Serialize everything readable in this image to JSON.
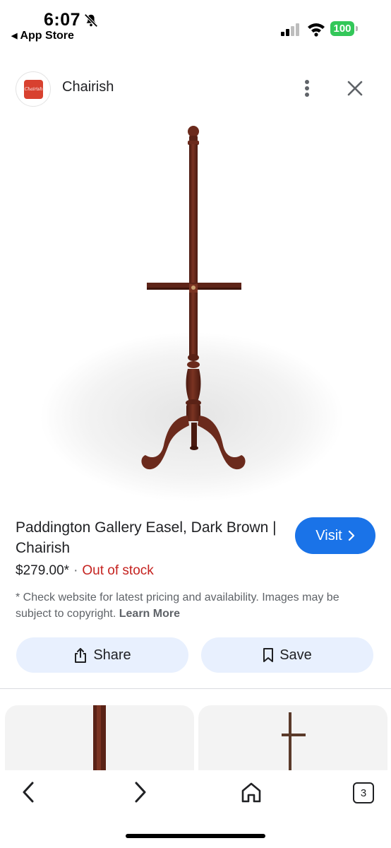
{
  "status_bar": {
    "time": "6:07",
    "back_app": "App Store",
    "battery": "100"
  },
  "header": {
    "logo_text": "Chairish",
    "site_name": "Chairish"
  },
  "product": {
    "title": "Paddington Gallery Easel, Dark Brown | Chairish",
    "price": "$279.00*",
    "separator": "·",
    "stock": "Out of stock",
    "visit_label": "Visit",
    "disclaimer": "* Check website for latest pricing and availability. Images may be subject to copyright.",
    "learn_more": "Learn More"
  },
  "actions": {
    "share_label": "Share",
    "save_label": "Save"
  },
  "nav": {
    "tab_count": "3"
  },
  "colors": {
    "accent": "#1a73e8",
    "out_of_stock": "#c5221f",
    "pill_bg": "#e8f0fe",
    "wood": "#6b2a1c",
    "battery": "#33c759",
    "logo": "#d8412f"
  },
  "icons": [
    "bell-slash-icon",
    "signal-icon",
    "wifi-icon",
    "battery-icon",
    "more-vert-icon",
    "close-icon",
    "chevron-right-icon",
    "share-icon",
    "bookmark-icon",
    "back-arrow-icon",
    "forward-arrow-icon",
    "home-icon",
    "tabs-icon"
  ]
}
